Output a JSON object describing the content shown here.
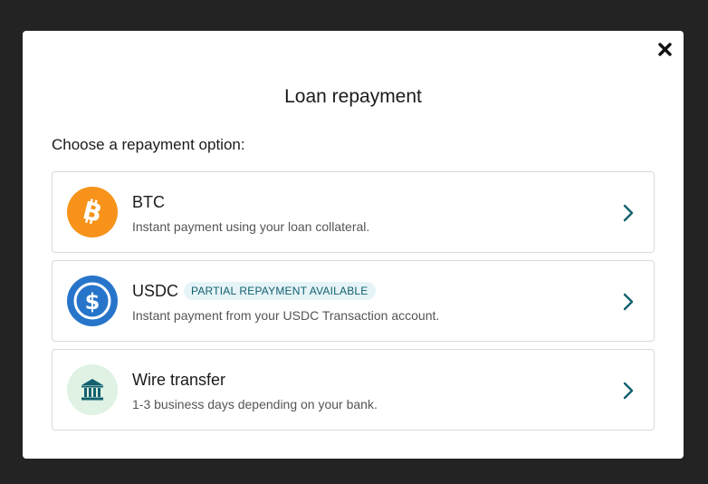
{
  "modal": {
    "title": "Loan repayment",
    "subtitle": "Choose a repayment option:",
    "close_icon": "close-icon"
  },
  "options": [
    {
      "title": "BTC",
      "description": "Instant payment using your loan collateral.",
      "icon": "bitcoin-icon",
      "color": "#f7931a"
    },
    {
      "title": "USDC",
      "badge": "PARTIAL REPAYMENT AVAILABLE",
      "description": "Instant payment from your USDC Transaction account.",
      "icon": "usdc-icon",
      "color": "#2775ca"
    },
    {
      "title": "Wire transfer",
      "description": "1-3 business days depending on your bank.",
      "icon": "bank-icon",
      "color": "#dff2e3"
    }
  ],
  "colors": {
    "accent": "#12606f",
    "backdrop": "#232323"
  }
}
